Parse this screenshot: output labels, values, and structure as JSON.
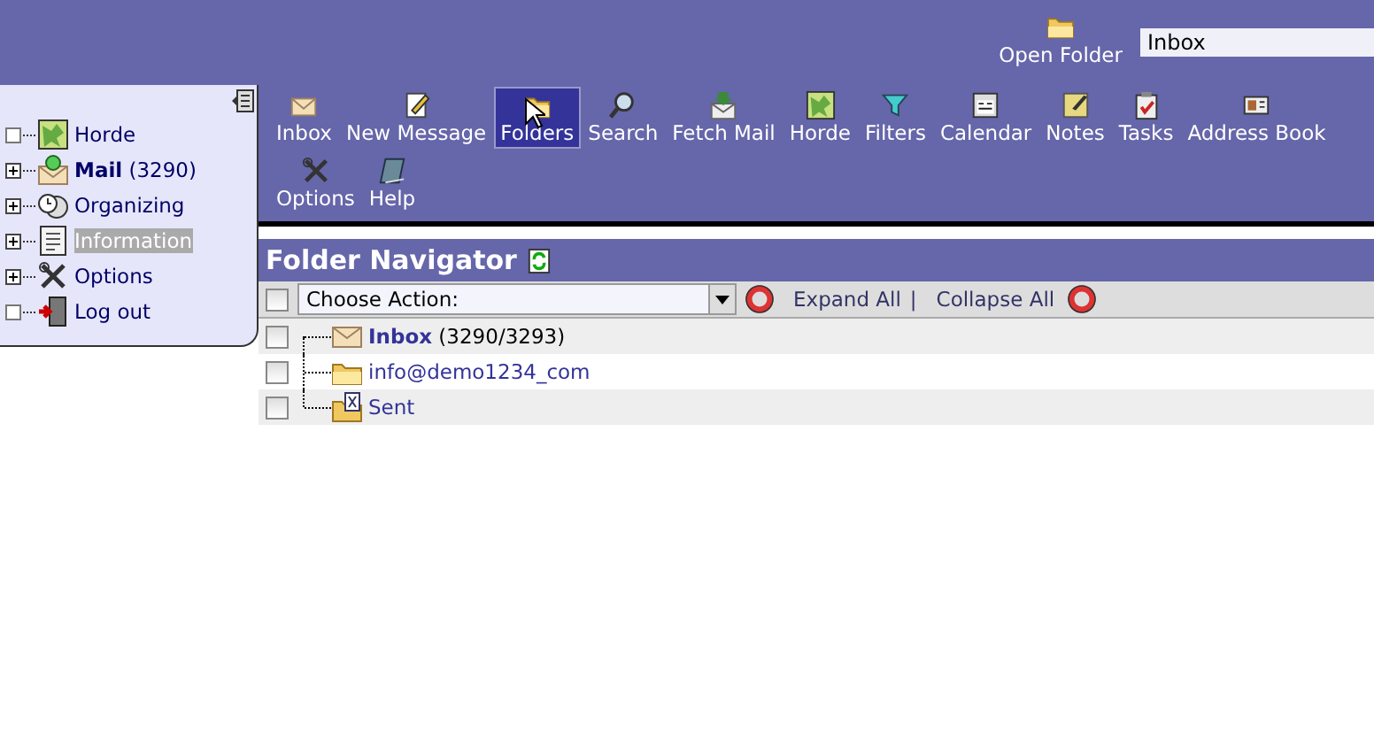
{
  "top_bar": {
    "open_folder_label": "Open Folder",
    "folder_field_value": "Inbox"
  },
  "sidebar": {
    "items": [
      {
        "label": "Horde",
        "bold": false,
        "expandable": false,
        "selected": false
      },
      {
        "label": "Mail",
        "count": "(3290)",
        "bold": true,
        "expandable": true,
        "selected": false
      },
      {
        "label": "Organizing",
        "bold": false,
        "expandable": true,
        "selected": false
      },
      {
        "label": "Information",
        "bold": false,
        "expandable": true,
        "selected": true
      },
      {
        "label": "Options",
        "bold": false,
        "expandable": true,
        "selected": false
      },
      {
        "label": "Log out",
        "bold": false,
        "expandable": false,
        "selected": false
      }
    ]
  },
  "toolbar": [
    {
      "label": "Inbox",
      "selected": false
    },
    {
      "label": "New Message",
      "selected": false
    },
    {
      "label": "Folders",
      "selected": true
    },
    {
      "label": "Search",
      "selected": false
    },
    {
      "label": "Fetch Mail",
      "selected": false
    },
    {
      "label": "Horde",
      "selected": false
    },
    {
      "label": "Filters",
      "selected": false
    },
    {
      "label": "Calendar",
      "selected": false
    },
    {
      "label": "Notes",
      "selected": false
    },
    {
      "label": "Tasks",
      "selected": false
    },
    {
      "label": "Address Book",
      "selected": false
    },
    {
      "label": "Options",
      "selected": false
    },
    {
      "label": "Help",
      "selected": false
    }
  ],
  "folder_navigator": {
    "title": "Folder Navigator",
    "select_all_checked": false,
    "action_select": "Choose Action:",
    "expand_all": "Expand All",
    "separator": "|",
    "collapse_all": "Collapse All",
    "folders": [
      {
        "kind": "mailbox",
        "name": "Inbox",
        "count": "(3290/3293)",
        "bold": true,
        "checked": false
      },
      {
        "kind": "folder",
        "name": "info@demo1234_com",
        "bold": false,
        "checked": false
      },
      {
        "kind": "sent",
        "name": "Sent",
        "bold": false,
        "checked": false
      }
    ]
  }
}
